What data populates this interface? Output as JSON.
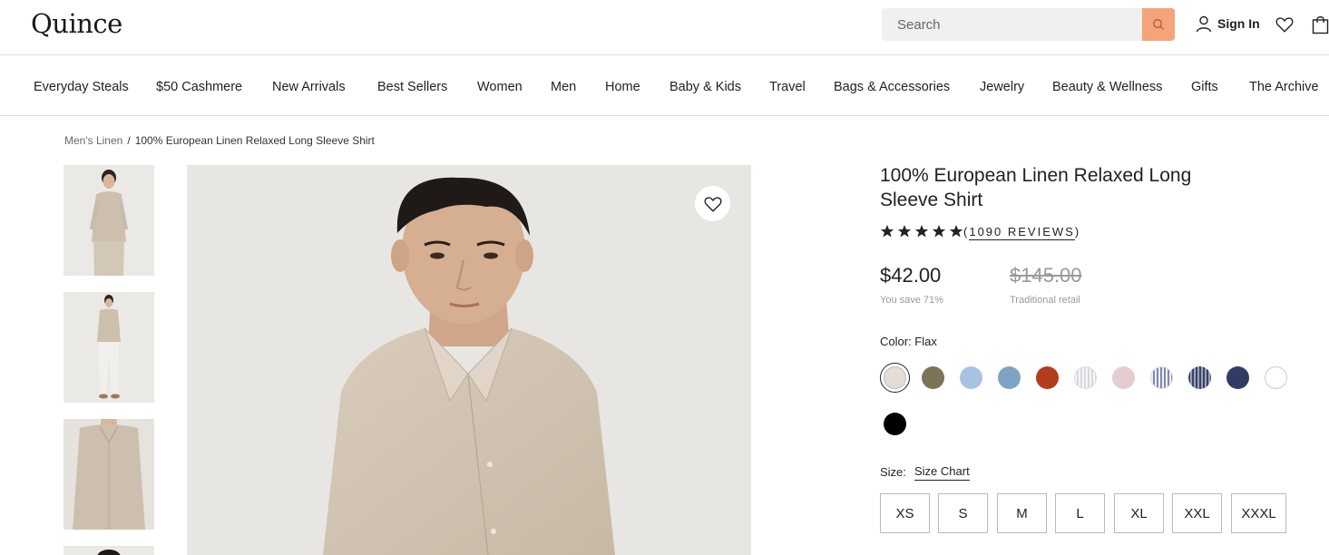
{
  "header": {
    "logo": "Quince",
    "search_placeholder": "Search",
    "sign_in": "Sign In"
  },
  "nav": [
    "Everyday Steals",
    "$50 Cashmere",
    "New Arrivals",
    "Best Sellers",
    "Women",
    "Men",
    "Home",
    "Baby & Kids",
    "Travel",
    "Bags & Accessories",
    "Jewelry",
    "Beauty & Wellness",
    "Gifts",
    "The Archive"
  ],
  "breadcrumb": {
    "parent": "Men's Linen",
    "separator": "/",
    "current": "100% European Linen Relaxed Long Sleeve Shirt"
  },
  "product": {
    "title": "100% European Linen Relaxed Long Sleeve Shirt",
    "rating": 5,
    "reviews_label": "(1090 REVIEWS)",
    "reviews_open": "(",
    "reviews_text": "1090 REVIEWS",
    "reviews_close": ")",
    "price": "$42.00",
    "save_text": "You save 71%",
    "original_price": "$145.00",
    "original_label": "Traditional retail",
    "color_label": "Color: Flax",
    "size_label": "Size:",
    "size_chart": "Size Chart",
    "sizes": [
      "XS",
      "S",
      "M",
      "L",
      "XL",
      "XXL",
      "XXXL"
    ]
  },
  "colors": {
    "accent_search": "#f4a37a",
    "swatches": [
      "#e3ddd6",
      "#7b7458",
      "#a7c2e3",
      "#7ea3c4",
      "#b13e1c",
      "stripe-light",
      "#e6ccd0",
      "stripe-blue",
      "stripe-navy",
      "#2f3d66",
      "#ffffff",
      "#000000"
    ]
  }
}
